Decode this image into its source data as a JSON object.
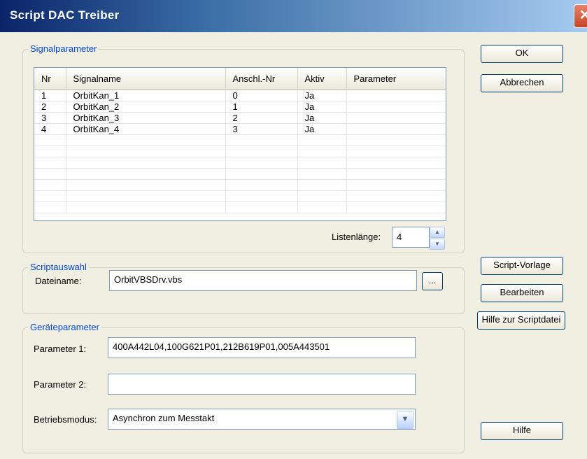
{
  "window": {
    "title": "Script DAC Treiber",
    "close_glyph": "✕"
  },
  "signal_group": {
    "label": "Signalparameter",
    "columns": [
      "Nr",
      "Signalname",
      "Anschl.-Nr",
      "Aktiv",
      "Parameter"
    ],
    "rows": [
      [
        "1",
        "OrbitKan_1",
        "0",
        "Ja",
        ""
      ],
      [
        "2",
        "OrbitKan_2",
        "1",
        "Ja",
        ""
      ],
      [
        "3",
        "OrbitKan_3",
        "2",
        "Ja",
        ""
      ],
      [
        "4",
        "OrbitKan_4",
        "3",
        "Ja",
        ""
      ],
      [
        "",
        "",
        "",
        "",
        ""
      ],
      [
        "",
        "",
        "",
        "",
        ""
      ],
      [
        "",
        "",
        "",
        "",
        ""
      ],
      [
        "",
        "",
        "",
        "",
        ""
      ],
      [
        "",
        "",
        "",
        "",
        ""
      ],
      [
        "",
        "",
        "",
        "",
        ""
      ],
      [
        "",
        "",
        "",
        "",
        ""
      ]
    ],
    "list_length_label": "Listenlänge:",
    "list_length_value": "4"
  },
  "script_group": {
    "label": "Scriptauswahl",
    "filename_label": "Dateiname:",
    "filename_value": "OrbitVBSDrv.vbs",
    "browse_label": "..."
  },
  "device_group": {
    "label": "Geräteparameter",
    "param1_label": "Parameter 1:",
    "param1_value": "400A442L04,100G621P01,212B619P01,005A443501",
    "param2_label": "Parameter 2:",
    "param2_value": "",
    "mode_label": "Betriebsmodus:",
    "mode_value": "Asynchron zum Messtakt"
  },
  "buttons": {
    "ok": "OK",
    "cancel": "Abbrechen",
    "script_template": "Script-Vorlage",
    "edit": "Bearbeiten",
    "script_help": "Hilfe zur Scriptdatei",
    "help": "Hilfe"
  },
  "icons": {
    "spin_up": "▲",
    "spin_down": "▼",
    "combo_arrow": "▼"
  }
}
